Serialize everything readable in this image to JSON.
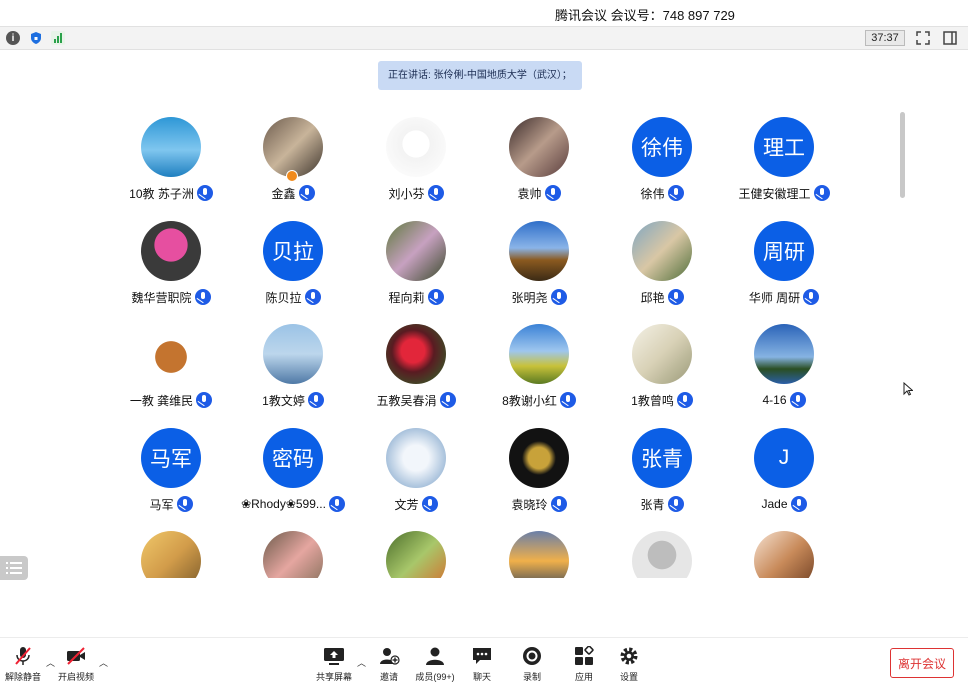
{
  "window": {
    "title": "腾讯会议 会议号：748 897 729"
  },
  "toolbar": {
    "timer": "37:37"
  },
  "banner": {
    "speaking": "正在讲话: 张伶俐-中国地质大学（武汉）；"
  },
  "participants": [
    {
      "name": "10教 苏子洲",
      "avatar_text": ""
    },
    {
      "name": "金鑫",
      "avatar_text": ""
    },
    {
      "name": "刘小芬",
      "avatar_text": ""
    },
    {
      "name": "袁帅",
      "avatar_text": ""
    },
    {
      "name": "徐伟",
      "avatar_text": "徐伟"
    },
    {
      "name": "王健安徽理工",
      "avatar_text": "理工"
    },
    {
      "name": "魏华营职院",
      "avatar_text": ""
    },
    {
      "name": "陈贝拉",
      "avatar_text": "贝拉"
    },
    {
      "name": "程向莉",
      "avatar_text": ""
    },
    {
      "name": "张明尧",
      "avatar_text": ""
    },
    {
      "name": "邱艳",
      "avatar_text": ""
    },
    {
      "name": "华师 周研",
      "avatar_text": "周研"
    },
    {
      "name": "一教 龚维民",
      "avatar_text": ""
    },
    {
      "name": "1教文婷",
      "avatar_text": ""
    },
    {
      "name": "五教吴春涓",
      "avatar_text": ""
    },
    {
      "name": "8教谢小红",
      "avatar_text": ""
    },
    {
      "name": "1教曾鸣",
      "avatar_text": ""
    },
    {
      "name": "4-16",
      "avatar_text": ""
    },
    {
      "name": "马军",
      "avatar_text": "马军"
    },
    {
      "name": "❀Rhody❀599...",
      "avatar_text": "密码"
    },
    {
      "name": "文芳",
      "avatar_text": ""
    },
    {
      "name": "袁晓玲",
      "avatar_text": ""
    },
    {
      "name": "张青",
      "avatar_text": "张青"
    },
    {
      "name": "Jade",
      "avatar_text": "J"
    },
    {
      "name": "",
      "avatar_text": ""
    },
    {
      "name": "",
      "avatar_text": ""
    },
    {
      "name": "",
      "avatar_text": ""
    },
    {
      "name": "",
      "avatar_text": ""
    },
    {
      "name": "",
      "avatar_text": ""
    },
    {
      "name": "",
      "avatar_text": ""
    }
  ],
  "bottombar": {
    "unmute": "解除静音",
    "video": "开启视频",
    "share": "共享屏幕",
    "invite": "邀请",
    "members": "成员(99+)",
    "chat": "聊天",
    "record": "录制",
    "apps": "应用",
    "settings": "设置",
    "leave": "离开会议"
  },
  "colors": {
    "accent": "#0b5fe6",
    "mic_badge": "#1e5be6",
    "leave": "#d33333",
    "banner": "#c9daf4"
  }
}
